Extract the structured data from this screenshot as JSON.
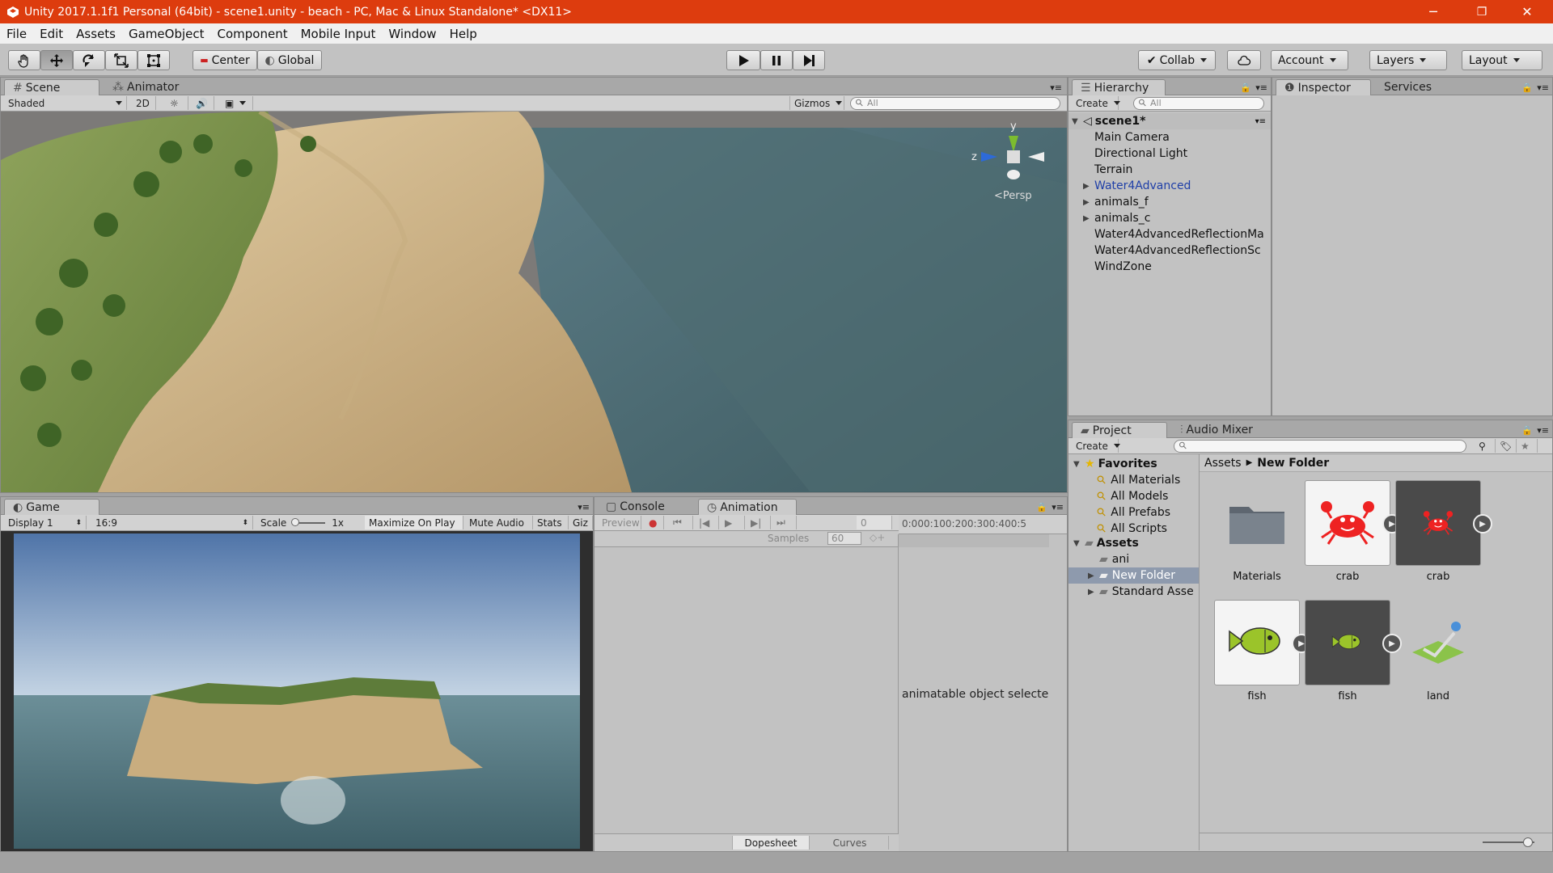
{
  "window": {
    "title": "Unity 2017.1.1f1 Personal (64bit) - scene1.unity - beach - PC, Mac & Linux Standalone* <DX11>",
    "minimize": "─",
    "restore": "❐",
    "close": "✕"
  },
  "menu": [
    "File",
    "Edit",
    "Assets",
    "GameObject",
    "Component",
    "Mobile Input",
    "Window",
    "Help"
  ],
  "toolbar": {
    "pivot_label": "Center",
    "space_label": "Global",
    "collab_label": "Collab",
    "account_label": "Account",
    "layers_label": "Layers",
    "layout_label": "Layout"
  },
  "scene_panel": {
    "tabs": [
      "Scene",
      "Animator"
    ],
    "shading": "Shaded",
    "mode_2d": "2D",
    "gizmos": "Gizmos",
    "search_placeholder": "All",
    "persp_label": "Persp",
    "axis_y": "y",
    "axis_z": "z"
  },
  "game_panel": {
    "tab": "Game",
    "display": "Display 1",
    "aspect": "16:9",
    "scale_label": "Scale",
    "scale_value": "1x",
    "maximize": "Maximize On Play",
    "mute": "Mute Audio",
    "stats": "Stats",
    "gizmos": "Giz"
  },
  "animation_panel": {
    "tabs": [
      "Console",
      "Animation"
    ],
    "preview": "Preview",
    "frame": "0",
    "samples_label": "Samples",
    "samples_value": "60",
    "ruler": "0:000:100:200:300:400:5",
    "message": "animatable object selecte",
    "bottom_tabs": [
      "Dopesheet",
      "Curves"
    ]
  },
  "hierarchy": {
    "tab": "Hierarchy",
    "create": "Create",
    "search_placeholder": "All",
    "scene_name": "scene1*",
    "items": [
      {
        "label": "Main Camera",
        "expand": false,
        "prefab": false
      },
      {
        "label": "Directional Light",
        "expand": false,
        "prefab": false
      },
      {
        "label": "Terrain",
        "expand": false,
        "prefab": false
      },
      {
        "label": "Water4Advanced",
        "expand": true,
        "prefab": true
      },
      {
        "label": "animals_f",
        "expand": true,
        "prefab": false
      },
      {
        "label": "animals_c",
        "expand": true,
        "prefab": false
      },
      {
        "label": "Water4AdvancedReflectionMa",
        "expand": false,
        "prefab": false
      },
      {
        "label": "Water4AdvancedReflectionSc",
        "expand": false,
        "prefab": false
      },
      {
        "label": "WindZone",
        "expand": false,
        "prefab": false
      }
    ]
  },
  "inspector": {
    "tabs": [
      "Inspector",
      "Services"
    ]
  },
  "project": {
    "tabs": [
      "Project",
      "Audio Mixer"
    ],
    "create": "Create",
    "favorites_label": "Favorites",
    "favorites": [
      "All Materials",
      "All Models",
      "All Prefabs",
      "All Scripts"
    ],
    "assets_label": "Assets",
    "folders": [
      {
        "label": "ani",
        "expand": false,
        "selected": false
      },
      {
        "label": "New Folder",
        "expand": true,
        "selected": true
      },
      {
        "label": "Standard Asse",
        "expand": true,
        "selected": false
      }
    ],
    "breadcrumb": [
      "Assets",
      "New Folder"
    ],
    "assets": [
      {
        "label": "Materials",
        "icon": "folder-icon"
      },
      {
        "label": "crab",
        "icon": "crab-icon"
      },
      {
        "label": "crab",
        "icon": "crab-icon"
      },
      {
        "label": "fish",
        "icon": "fish-icon"
      },
      {
        "label": "fish",
        "icon": "fish-icon"
      },
      {
        "label": "land",
        "icon": "land-icon"
      }
    ]
  },
  "colors": {
    "title_bar": "#dd3c0e",
    "selection": "#8e9aad",
    "prefab_text": "#1f3fa8"
  }
}
